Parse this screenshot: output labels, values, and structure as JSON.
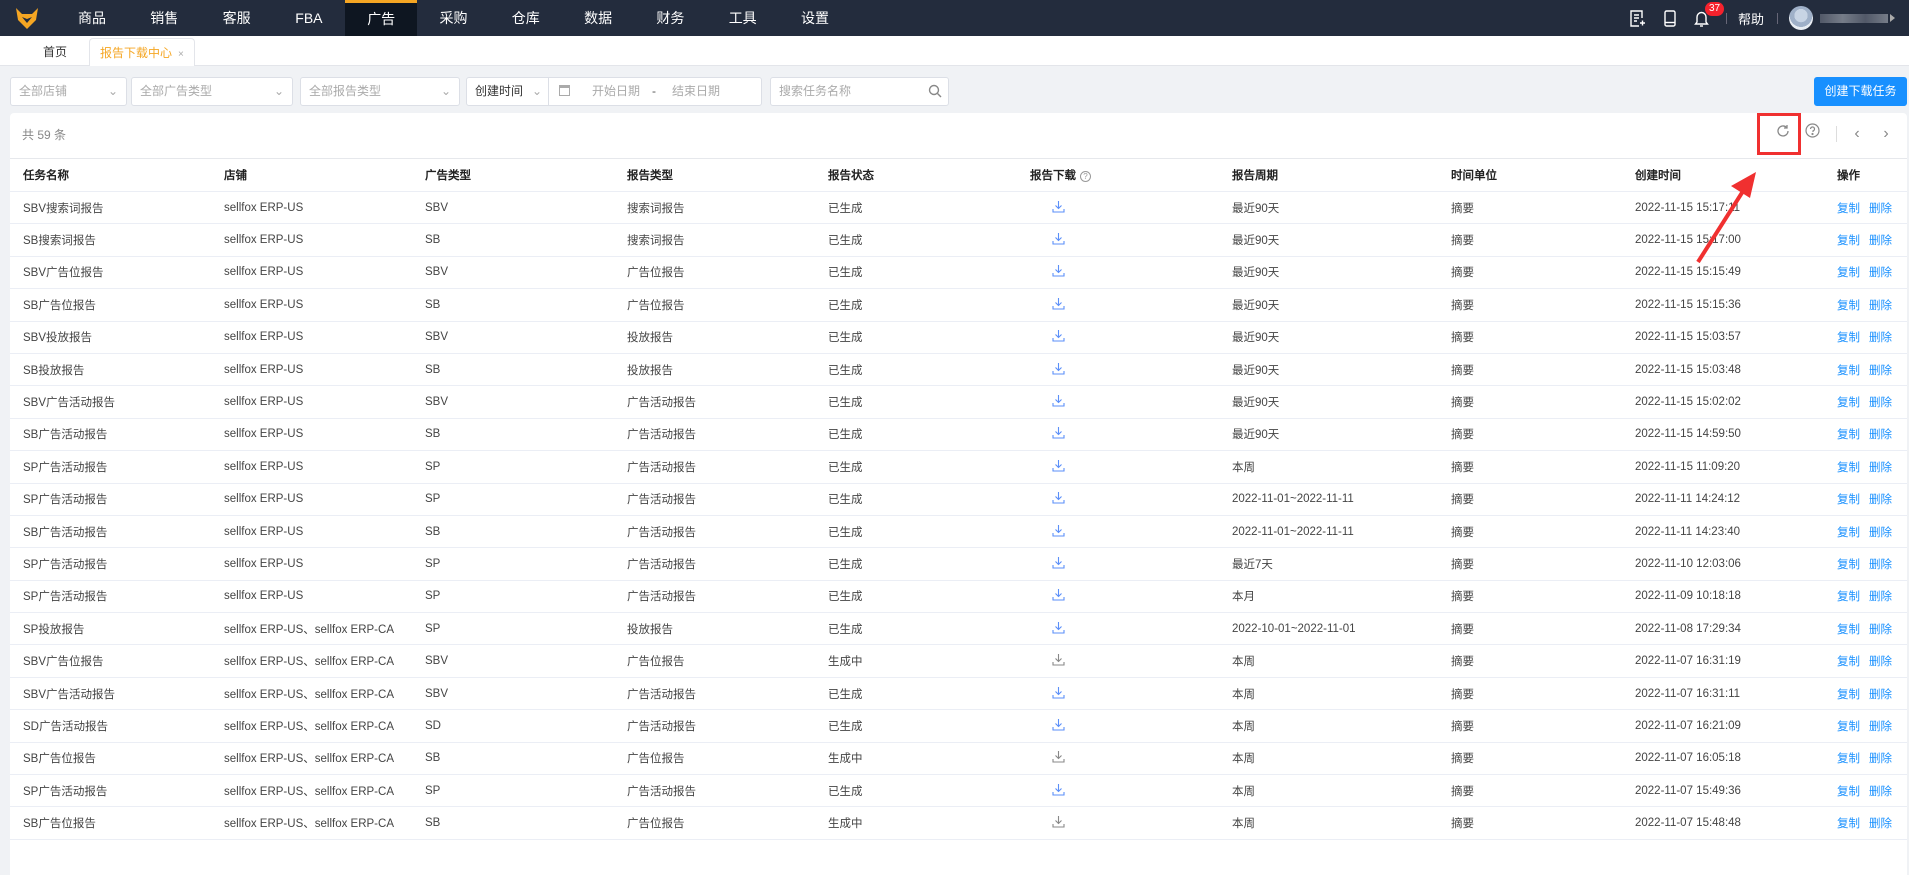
{
  "nav": {
    "items": [
      "商品",
      "销售",
      "客服",
      "FBA",
      "广告",
      "采购",
      "仓库",
      "数据",
      "财务",
      "工具",
      "设置"
    ],
    "active_index": 4,
    "notification_count": "37",
    "help": "帮助"
  },
  "tabs": {
    "home": "首页",
    "current": "报告下载中心",
    "close": "×"
  },
  "filters": {
    "shop": "全部店铺",
    "ad_type": "全部广告类型",
    "report_type": "全部报告类型",
    "time_field": "创建时间",
    "start_date": "开始日期",
    "date_sep": "-",
    "end_date": "结束日期",
    "search_placeholder": "搜索任务名称"
  },
  "create_button": "创建下载任务",
  "total": "共 59 条",
  "columns": [
    "任务名称",
    "店铺",
    "广告类型",
    "报告类型",
    "报告状态",
    "报告下载",
    "报告周期",
    "时间单位",
    "创建时间",
    "操作"
  ],
  "actions": {
    "copy": "复制",
    "delete": "删除"
  },
  "colors": {
    "accent": "#1890ff",
    "nav_bg": "#232c3d",
    "brand": "#f5a623",
    "highlight": "#f03030"
  },
  "rows": [
    {
      "name": "SBV搜索词报告",
      "shop": "sellfox ERP-US",
      "ad_type": "SBV",
      "report_type": "搜索词报告",
      "status": "已生成",
      "period": "最近90天",
      "unit": "摘要",
      "created": "2022-11-15 15:17:11",
      "download_enabled": true
    },
    {
      "name": "SB搜索词报告",
      "shop": "sellfox ERP-US",
      "ad_type": "SB",
      "report_type": "搜索词报告",
      "status": "已生成",
      "period": "最近90天",
      "unit": "摘要",
      "created": "2022-11-15 15:17:00",
      "download_enabled": true
    },
    {
      "name": "SBV广告位报告",
      "shop": "sellfox ERP-US",
      "ad_type": "SBV",
      "report_type": "广告位报告",
      "status": "已生成",
      "period": "最近90天",
      "unit": "摘要",
      "created": "2022-11-15 15:15:49",
      "download_enabled": true
    },
    {
      "name": "SB广告位报告",
      "shop": "sellfox ERP-US",
      "ad_type": "SB",
      "report_type": "广告位报告",
      "status": "已生成",
      "period": "最近90天",
      "unit": "摘要",
      "created": "2022-11-15 15:15:36",
      "download_enabled": true
    },
    {
      "name": "SBV投放报告",
      "shop": "sellfox ERP-US",
      "ad_type": "SBV",
      "report_type": "投放报告",
      "status": "已生成",
      "period": "最近90天",
      "unit": "摘要",
      "created": "2022-11-15 15:03:57",
      "download_enabled": true
    },
    {
      "name": "SB投放报告",
      "shop": "sellfox ERP-US",
      "ad_type": "SB",
      "report_type": "投放报告",
      "status": "已生成",
      "period": "最近90天",
      "unit": "摘要",
      "created": "2022-11-15 15:03:48",
      "download_enabled": true
    },
    {
      "name": "SBV广告活动报告",
      "shop": "sellfox ERP-US",
      "ad_type": "SBV",
      "report_type": "广告活动报告",
      "status": "已生成",
      "period": "最近90天",
      "unit": "摘要",
      "created": "2022-11-15 15:02:02",
      "download_enabled": true
    },
    {
      "name": "SB广告活动报告",
      "shop": "sellfox ERP-US",
      "ad_type": "SB",
      "report_type": "广告活动报告",
      "status": "已生成",
      "period": "最近90天",
      "unit": "摘要",
      "created": "2022-11-15 14:59:50",
      "download_enabled": true
    },
    {
      "name": "SP广告活动报告",
      "shop": "sellfox ERP-US",
      "ad_type": "SP",
      "report_type": "广告活动报告",
      "status": "已生成",
      "period": "本周",
      "unit": "摘要",
      "created": "2022-11-15 11:09:20",
      "download_enabled": true
    },
    {
      "name": "SP广告活动报告",
      "shop": "sellfox ERP-US",
      "ad_type": "SP",
      "report_type": "广告活动报告",
      "status": "已生成",
      "period": "2022-11-01~2022-11-11",
      "unit": "摘要",
      "created": "2022-11-11 14:24:12",
      "download_enabled": true
    },
    {
      "name": "SB广告活动报告",
      "shop": "sellfox ERP-US",
      "ad_type": "SB",
      "report_type": "广告活动报告",
      "status": "已生成",
      "period": "2022-11-01~2022-11-11",
      "unit": "摘要",
      "created": "2022-11-11 14:23:40",
      "download_enabled": true
    },
    {
      "name": "SP广告活动报告",
      "shop": "sellfox ERP-US",
      "ad_type": "SP",
      "report_type": "广告活动报告",
      "status": "已生成",
      "period": "最近7天",
      "unit": "摘要",
      "created": "2022-11-10 12:03:06",
      "download_enabled": true
    },
    {
      "name": "SP广告活动报告",
      "shop": "sellfox ERP-US",
      "ad_type": "SP",
      "report_type": "广告活动报告",
      "status": "已生成",
      "period": "本月",
      "unit": "摘要",
      "created": "2022-11-09 10:18:18",
      "download_enabled": true
    },
    {
      "name": "SP投放报告",
      "shop": "sellfox ERP-US、sellfox ERP-CA",
      "ad_type": "SP",
      "report_type": "投放报告",
      "status": "已生成",
      "period": "2022-10-01~2022-11-01",
      "unit": "摘要",
      "created": "2022-11-08 17:29:34",
      "download_enabled": true
    },
    {
      "name": "SBV广告位报告",
      "shop": "sellfox ERP-US、sellfox ERP-CA",
      "ad_type": "SBV",
      "report_type": "广告位报告",
      "status": "生成中",
      "period": "本周",
      "unit": "摘要",
      "created": "2022-11-07 16:31:19",
      "download_enabled": false
    },
    {
      "name": "SBV广告活动报告",
      "shop": "sellfox ERP-US、sellfox ERP-CA",
      "ad_type": "SBV",
      "report_type": "广告活动报告",
      "status": "已生成",
      "period": "本周",
      "unit": "摘要",
      "created": "2022-11-07 16:31:11",
      "download_enabled": true
    },
    {
      "name": "SD广告活动报告",
      "shop": "sellfox ERP-US、sellfox ERP-CA",
      "ad_type": "SD",
      "report_type": "广告活动报告",
      "status": "已生成",
      "period": "本周",
      "unit": "摘要",
      "created": "2022-11-07 16:21:09",
      "download_enabled": true
    },
    {
      "name": "SB广告位报告",
      "shop": "sellfox ERP-US、sellfox ERP-CA",
      "ad_type": "SB",
      "report_type": "广告位报告",
      "status": "生成中",
      "period": "本周",
      "unit": "摘要",
      "created": "2022-11-07 16:05:18",
      "download_enabled": false
    },
    {
      "name": "SP广告活动报告",
      "shop": "sellfox ERP-US、sellfox ERP-CA",
      "ad_type": "SP",
      "report_type": "广告活动报告",
      "status": "已生成",
      "period": "本周",
      "unit": "摘要",
      "created": "2022-11-07 15:49:36",
      "download_enabled": true
    },
    {
      "name": "SB广告位报告",
      "shop": "sellfox ERP-US、sellfox ERP-CA",
      "ad_type": "SB",
      "report_type": "广告位报告",
      "status": "生成中",
      "period": "本周",
      "unit": "摘要",
      "created": "2022-11-07 15:48:48",
      "download_enabled": false
    }
  ]
}
